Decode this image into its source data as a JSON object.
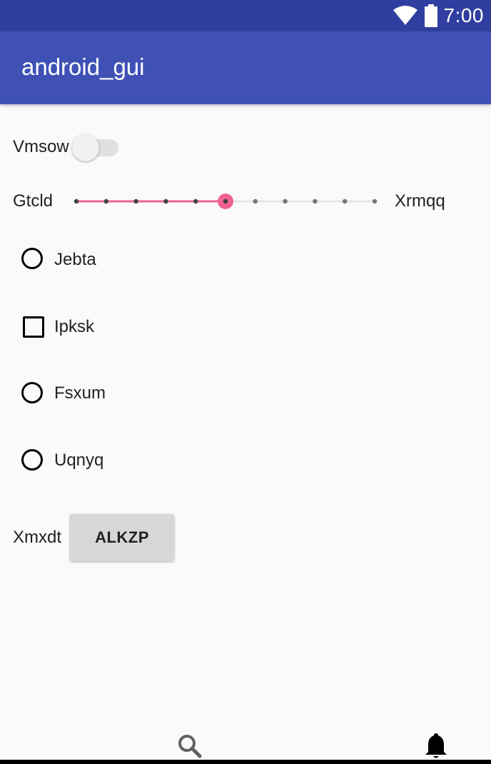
{
  "status_bar": {
    "time": "7:00",
    "icons": [
      "wifi-icon",
      "battery-icon"
    ],
    "color": "#303f9f"
  },
  "app_bar": {
    "title": "android_gui",
    "color": "#3f51b5"
  },
  "switch": {
    "label": "Vmsow",
    "checked": false
  },
  "slider": {
    "label_start": "Gtcld",
    "label_end": "Xrmqq",
    "value": 5,
    "max": 10,
    "accent_color": "#f06292"
  },
  "options": [
    {
      "type": "radio",
      "label": "Jebta",
      "checked": false
    },
    {
      "type": "checkbox",
      "label": "Ipksk",
      "checked": false
    },
    {
      "type": "radio",
      "label": "Fsxum",
      "checked": false
    },
    {
      "type": "radio",
      "label": "Uqnyq",
      "checked": false
    }
  ],
  "button_row": {
    "label": "Xmxdt",
    "button_label": "ALKZP"
  },
  "bottom_nav": {
    "icons": [
      "search-icon",
      "bell-icon"
    ]
  }
}
